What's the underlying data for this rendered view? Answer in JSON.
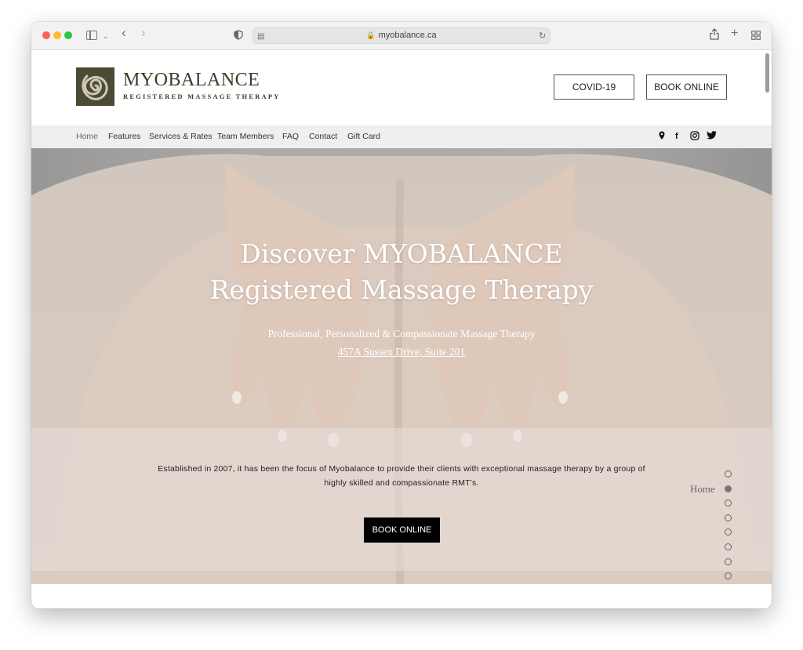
{
  "browser": {
    "url": "myobalance.ca"
  },
  "header": {
    "logo_title": "MYOBALANCE",
    "logo_subtitle": "REGISTERED MASSAGE THERAPY",
    "covid_label": "COVID-19",
    "book_label": "BOOK ONLINE"
  },
  "nav": {
    "items": [
      "Home",
      "Features",
      "Services & Rates",
      "Team Members",
      "FAQ",
      "Contact",
      "Gift Card"
    ],
    "social_icons": [
      "map-pin-icon",
      "facebook-icon",
      "instagram-icon",
      "twitter-icon"
    ]
  },
  "hero": {
    "title_line1": "Discover MYOBALANCE",
    "title_line2": "Registered Massage Therapy",
    "subtitle": "Professional, Personalized & Compassionate Massage Therapy",
    "address": "457A Sussex Drive, Suite 201",
    "band_text": "Established in 2007, it has been the focus of Myobalance to provide their clients with exceptional massage therapy by a group of highly skilled and compassionate RMT's.",
    "book_label": "BOOK ONLINE",
    "anchor_label": "Home",
    "anchor_count": 8,
    "active_anchor": 2
  }
}
